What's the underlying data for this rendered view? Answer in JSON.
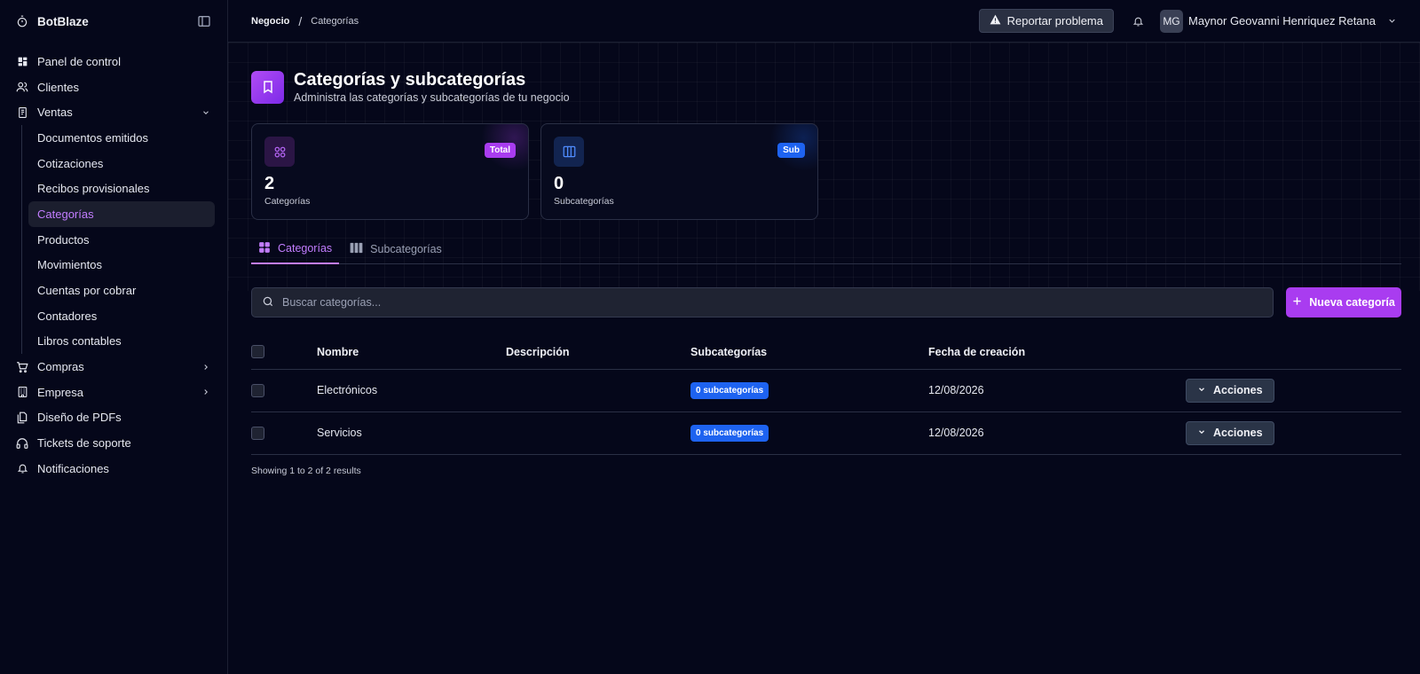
{
  "brand": {
    "name": "BotBlaze"
  },
  "sidebar": {
    "items": [
      {
        "label": "Panel de control",
        "icon": "grid-icon"
      },
      {
        "label": "Clientes",
        "icon": "users-icon"
      },
      {
        "label": "Ventas",
        "icon": "receipt-icon",
        "expanded": true
      },
      {
        "label": "Compras",
        "icon": "cart-icon"
      },
      {
        "label": "Empresa",
        "icon": "building-icon"
      },
      {
        "label": "Diseño de PDFs",
        "icon": "files-icon"
      },
      {
        "label": "Tickets de soporte",
        "icon": "headset-icon"
      },
      {
        "label": "Notificaciones",
        "icon": "bell-icon"
      }
    ],
    "ventas_sub": [
      {
        "label": "Documentos emitidos"
      },
      {
        "label": "Cotizaciones"
      },
      {
        "label": "Recibos provisionales"
      },
      {
        "label": "Categorías",
        "active": true
      },
      {
        "label": "Productos"
      },
      {
        "label": "Movimientos"
      },
      {
        "label": "Cuentas por cobrar"
      },
      {
        "label": "Contadores"
      },
      {
        "label": "Libros contables"
      }
    ]
  },
  "topbar": {
    "breadcrumb": [
      "Negocio",
      "Categorías"
    ],
    "report_label": "Reportar problema",
    "user_initials": "MG",
    "user_name": "Maynor Geovanni Henriquez Retana"
  },
  "page": {
    "title": "Categorías y subcategorías",
    "subtitle": "Administra las categorías y subcategorías de tu negocio"
  },
  "stats": [
    {
      "value": "2",
      "label": "Categorías",
      "badge": "Total",
      "accent": "#a93cf0"
    },
    {
      "value": "0",
      "label": "Subcategorías",
      "badge": "Sub",
      "accent": "#1e63f0"
    }
  ],
  "tabs": [
    {
      "label": "Categorías",
      "active": true
    },
    {
      "label": "Subcategorías"
    }
  ],
  "search": {
    "placeholder": "Buscar categorías..."
  },
  "new_button": "Nueva categoría",
  "table": {
    "headers": [
      "Nombre",
      "Descripción",
      "Subcategorías",
      "Fecha de creación"
    ],
    "rows": [
      {
        "name": "Electrónicos",
        "description": "",
        "subcategories": "0 subcategorías",
        "date": "12/08/2026",
        "action": "Acciones"
      },
      {
        "name": "Servicios",
        "description": "",
        "subcategories": "0 subcategorías",
        "date": "12/08/2026",
        "action": "Acciones"
      }
    ]
  },
  "footer": "Showing 1 to 2 of 2 results"
}
